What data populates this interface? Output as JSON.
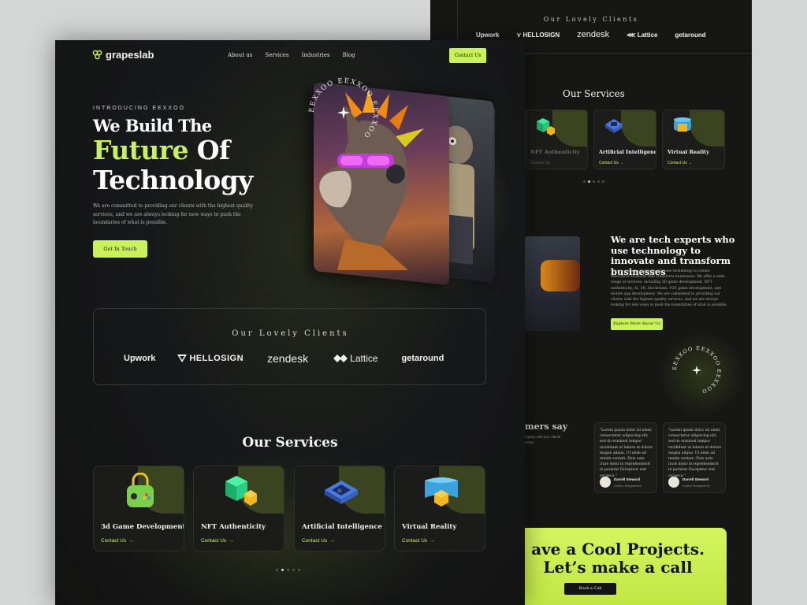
{
  "colors": {
    "accent": "#c9f25a",
    "bg": "#151614",
    "text": "#f1f1ee"
  },
  "header": {
    "logo": "grapeslab",
    "nav": [
      "About us",
      "Services",
      "Industries",
      "Blog"
    ],
    "contact_label": "Contact Us"
  },
  "hero": {
    "intro": "INTRODUCING EEXXOO",
    "title_line1": "We Build  The",
    "title_accent": "Future",
    "title_line2_rest": " Of",
    "title_line3": "Technology",
    "description": "We are committed to providing our clients with the highest quality services, and we are always looking for new ways to push the boundaries of what is possible.",
    "button_label": "Get In Touch",
    "badge_text": "EEXXOO EEXXOO EEXXOO"
  },
  "clients": {
    "title": "Our Lovely Clients",
    "logos": [
      "Upwork",
      "HELLOSIGN",
      "zendesk",
      "Lattice",
      "getaround"
    ]
  },
  "services": {
    "title": "Our Services",
    "cards": [
      {
        "title": "3d Game Development",
        "link": "Contact Us",
        "icon": "game-controller-lock-icon"
      },
      {
        "title": "NFT Authenticity",
        "link": "Contact Us",
        "icon": "cube-coin-icon"
      },
      {
        "title": "Artificial Intelligence",
        "link": "Contact Us",
        "icon": "ai-chip-icon"
      },
      {
        "title": "Virtual Reality",
        "link": "Contact Us",
        "icon": "vr-cylinder-icon"
      }
    ],
    "active_dot": 2
  },
  "back_page": {
    "clients_title": "Our Lovely Clients",
    "services_title": "Our Services",
    "cards": [
      {
        "title": "NFT Authenticity",
        "link": "Contact Us"
      },
      {
        "title": "Artificial Intelligence",
        "link": "Contact Us"
      },
      {
        "title": "Virtual Reality",
        "link": "Contact Us"
      }
    ],
    "about_title": "We are tech experts who use technology to innovate and transform businesses",
    "about_text": "We are a team of experts who use technology to create innovative solutions that transform businesses. We offer a wide range of services, including 3D game development, NFT authenticity, AI, VR, blockchain, P2E game development, and mobile app development. We are committed to providing our clients with the highest quality services, and we are always looking for new ways to push the boundaries of what is possible.",
    "about_button": "Explore More About Us",
    "testimonials_title": "mers say",
    "testimonials_sub": "mpany with you clients ucess",
    "testimonials": [
      {
        "quote": "\"Lorem ipsum dolor sit amet, consectetur adipiscing elit, sed do eiusmod tempor incididunt ut labore et dolore magna aliqua. Ut enim ad minim veniam. Duis aute irure dolor in reprehenderit in pariatur Excepteur sint occaeca.\"",
        "name": "Darrell Steward",
        "location": "Dhaka, Bangladesh"
      },
      {
        "quote": "\"Lorem ipsum dolor sit amet, consectetur adipiscing elit, sed do eiusmod tempor incididunt ut labore et dolore magna aliqua. Ut enim ad minim veniam. Duis aute irure dolor in reprehenderit in pariatur Excepteur sint occaeca.\"",
        "name": "Darrell Steward",
        "location": "Dhaka, Bangladesh"
      }
    ],
    "cta_line1": "ave a Cool Projects.",
    "cta_line2": "Let’s make a call",
    "cta_button": "Book a Call"
  }
}
